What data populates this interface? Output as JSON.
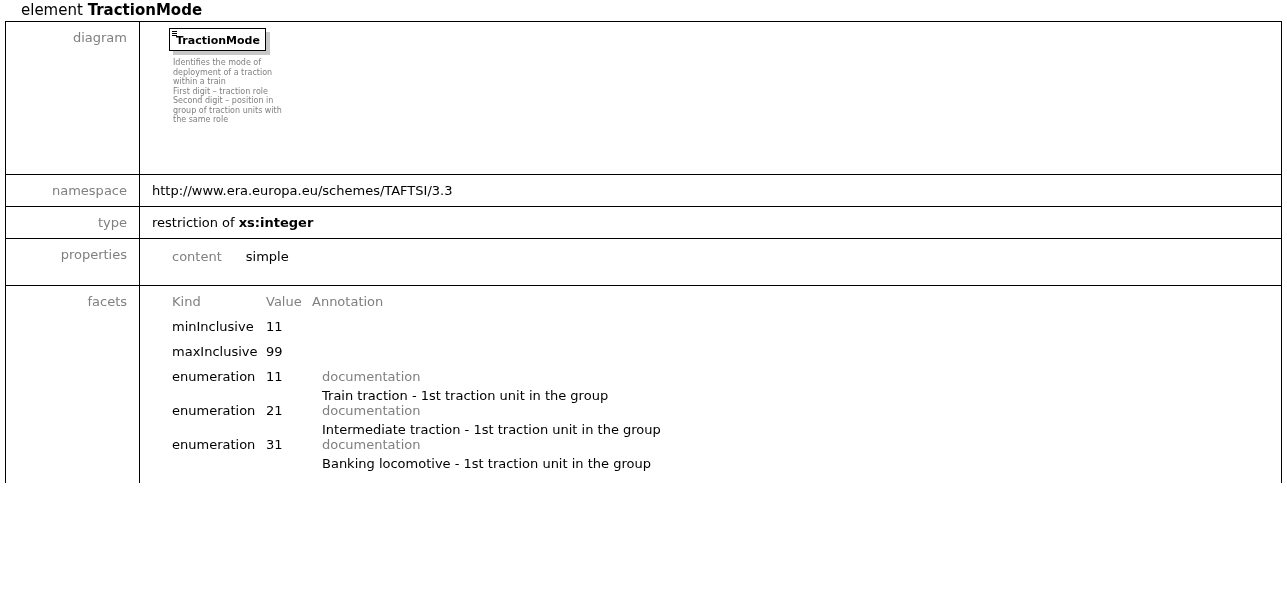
{
  "heading": {
    "prefix": "element",
    "name": "TractionMode"
  },
  "diagram": {
    "label": "diagram",
    "element_name": "TractionMode",
    "description": [
      "Identifies the mode of",
      "deployment of a traction",
      "within a train",
      "First digit – traction role",
      "Second digit – position in",
      "group of traction units with",
      "the same role"
    ]
  },
  "namespace": {
    "label": "namespace",
    "value": "http://www.era.europa.eu/schemes/TAFTSI/3.3"
  },
  "type": {
    "label": "type",
    "value": "restriction of **xs:integer**"
  },
  "properties": {
    "label": "properties",
    "items": [
      {
        "name": "content",
        "value": "simple"
      }
    ]
  },
  "facets": {
    "label": "facets",
    "columns": [
      "Kind",
      "Value",
      "Annotation"
    ],
    "rows": [
      {
        "kind": "minInclusive",
        "value": "11"
      },
      {
        "kind": "maxInclusive",
        "value": "99"
      },
      {
        "kind": "enumeration",
        "value": "11",
        "annotation_label": "documentation",
        "annotation": "Train traction - 1st traction unit in the group"
      },
      {
        "kind": "enumeration",
        "value": "21",
        "annotation_label": "documentation",
        "annotation": "Intermediate traction - 1st traction unit in the group"
      },
      {
        "kind": "enumeration",
        "value": "31",
        "annotation_label": "documentation",
        "annotation": "Banking locomotive - 1st traction unit in the group"
      }
    ]
  }
}
